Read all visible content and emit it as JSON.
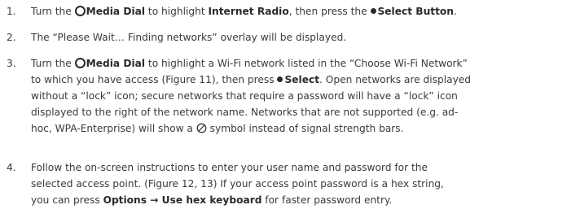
{
  "steps": [
    {
      "number": "1.",
      "lines": [
        {
          "parts": {
            "a": "Turn the ",
            "b": "Media Dial",
            "c": " to highlight ",
            "d": "Internet Radio",
            "e": ", then press the ",
            "f": "Select Button",
            "g": "."
          }
        }
      ]
    },
    {
      "number": "2.",
      "text": "The “Please Wait… Finding networks” overlay will be displayed."
    },
    {
      "number": "3.",
      "line1": {
        "a": "Turn the ",
        "b": "Media Dial",
        "c": " to highlight a Wi-Fi network listed in the “Choose Wi-Fi Network”"
      },
      "line2": {
        "a": "to which you have access (Figure 11), then press ",
        "b": "Select",
        "c": ". Open networks are displayed"
      },
      "line3": "without a “lock” icon; secure networks that require a password will have a “lock” icon",
      "line4": "displayed to the right of the network name. Networks that are not supported (e.g. ad-",
      "line5": {
        "a": "hoc, WPA-Enterprise) will show a ",
        "b": " symbol instead of signal strength bars."
      }
    },
    {
      "number": "4.",
      "line1": "Follow the on-screen instructions to enter your user name and password for the",
      "line2": "selected access point. (Figure 12, 13) If your access point password is a hex string,",
      "line3": {
        "a": "you can press ",
        "b": "Options → Use hex keyboard",
        "c": " for faster password entry."
      }
    }
  ],
  "icons": {
    "media_dial": "media-dial-icon",
    "select_button": "select-button-icon",
    "not_supported": "no-entry-icon"
  }
}
